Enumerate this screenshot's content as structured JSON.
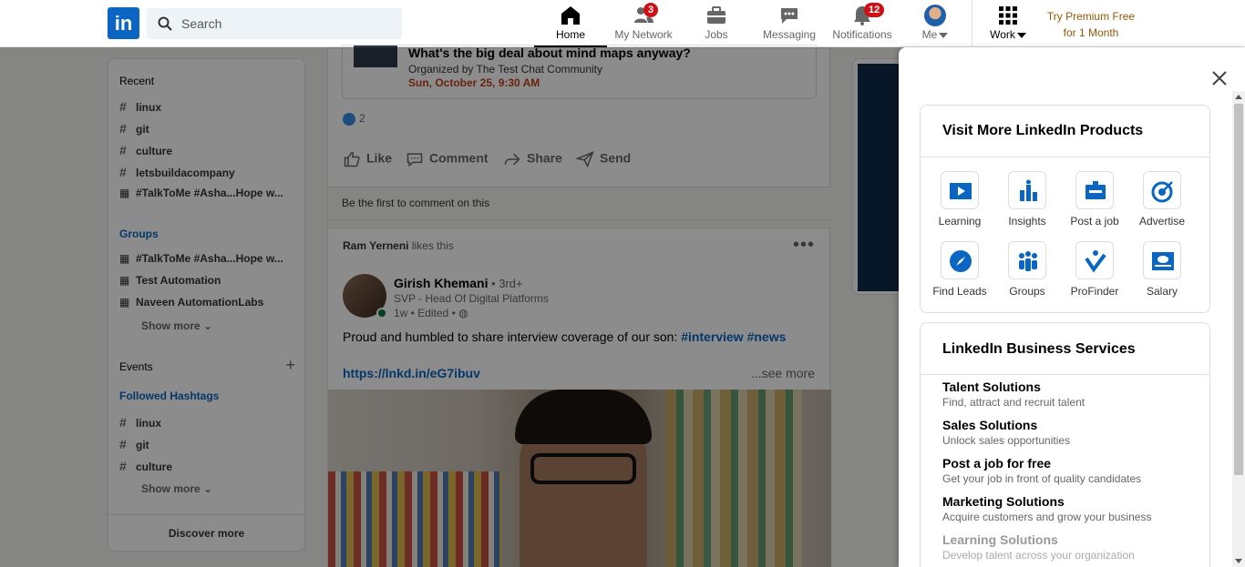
{
  "header": {
    "logo": "in",
    "search_placeholder": "Search",
    "nav": [
      {
        "label": "Home",
        "icon": "home-icon"
      },
      {
        "label": "My Network",
        "icon": "network-icon",
        "badge": "3"
      },
      {
        "label": "Jobs",
        "icon": "briefcase-icon"
      },
      {
        "label": "Messaging",
        "icon": "chat-icon"
      },
      {
        "label": "Notifications",
        "icon": "bell-icon",
        "badge": "12"
      },
      {
        "label": "Me",
        "icon": "avatar"
      },
      {
        "label": "Work",
        "icon": "grid-icon"
      }
    ],
    "premium": [
      "Try Premium Free",
      "for 1 Month"
    ]
  },
  "left": {
    "recent_title": "Recent",
    "recent": [
      "linux",
      "git",
      "culture",
      "letsbuildacompany",
      "#TalkToMe #Asha...Hope w..."
    ],
    "groups_title": "Groups",
    "groups": [
      "#TalkToMe #Asha...Hope w...",
      "Test Automation",
      "Naveen AutomationLabs"
    ],
    "show_more": "Show more",
    "events_title": "Events",
    "followed_title": "Followed Hashtags",
    "followed": [
      "linux",
      "git",
      "culture"
    ],
    "discover": "Discover more"
  },
  "feed": {
    "event_title": "What's the big deal about mind maps anyway?",
    "event_org": "Organized by The Test Chat Community",
    "event_date": "Sun, October 25, 9:30 AM",
    "likes_count": "2",
    "actions": [
      "Like",
      "Comment",
      "Share",
      "Send"
    ],
    "first_comment": "Be the first to comment on this",
    "liker": "Ram Yerneni",
    "liker_suffix": " likes this",
    "author": "Girish Khemani",
    "author_degree": " • 3rd+",
    "author_title": "SVP - Head Of Digital Platforms",
    "post_time": "1w • Edited •",
    "post_text": "Proud and humbled to share interview coverage of our son: ",
    "post_tags": "#interview #news",
    "post_link": "https://lnkd.in/eG7ibuv",
    "see_more": "...see more"
  },
  "panel": {
    "products_title": "Visit More LinkedIn Products",
    "products": [
      {
        "label": "Learning",
        "icon": "learning-icon",
        "color": "#0a66c2"
      },
      {
        "label": "Insights",
        "icon": "insights-icon",
        "color": "#0a66c2"
      },
      {
        "label": "Post a job",
        "icon": "post-job-icon",
        "color": "#0a66c2"
      },
      {
        "label": "Advertise",
        "icon": "advertise-icon",
        "color": "#0a66c2"
      },
      {
        "label": "Find Leads",
        "icon": "compass-icon",
        "color": "#0a66c2"
      },
      {
        "label": "Groups",
        "icon": "groups-icon",
        "color": "#0a66c2"
      },
      {
        "label": "ProFinder",
        "icon": "profinder-icon",
        "color": "#0a66c2"
      },
      {
        "label": "Salary",
        "icon": "salary-icon",
        "color": "#0a66c2"
      }
    ],
    "business_title": "LinkedIn Business Services",
    "services": [
      {
        "title": "Talent Solutions",
        "desc": "Find, attract and recruit talent"
      },
      {
        "title": "Sales Solutions",
        "desc": "Unlock sales opportunities"
      },
      {
        "title": "Post a job for free",
        "desc": "Get your job in front of quality candidates"
      },
      {
        "title": "Marketing Solutions",
        "desc": "Acquire customers and grow your business"
      },
      {
        "title": "Learning Solutions",
        "desc": "Develop talent across your organization"
      }
    ]
  },
  "colors": {
    "brand": "#0a66c2",
    "premium": "#915907",
    "badge": "#cc1016"
  }
}
